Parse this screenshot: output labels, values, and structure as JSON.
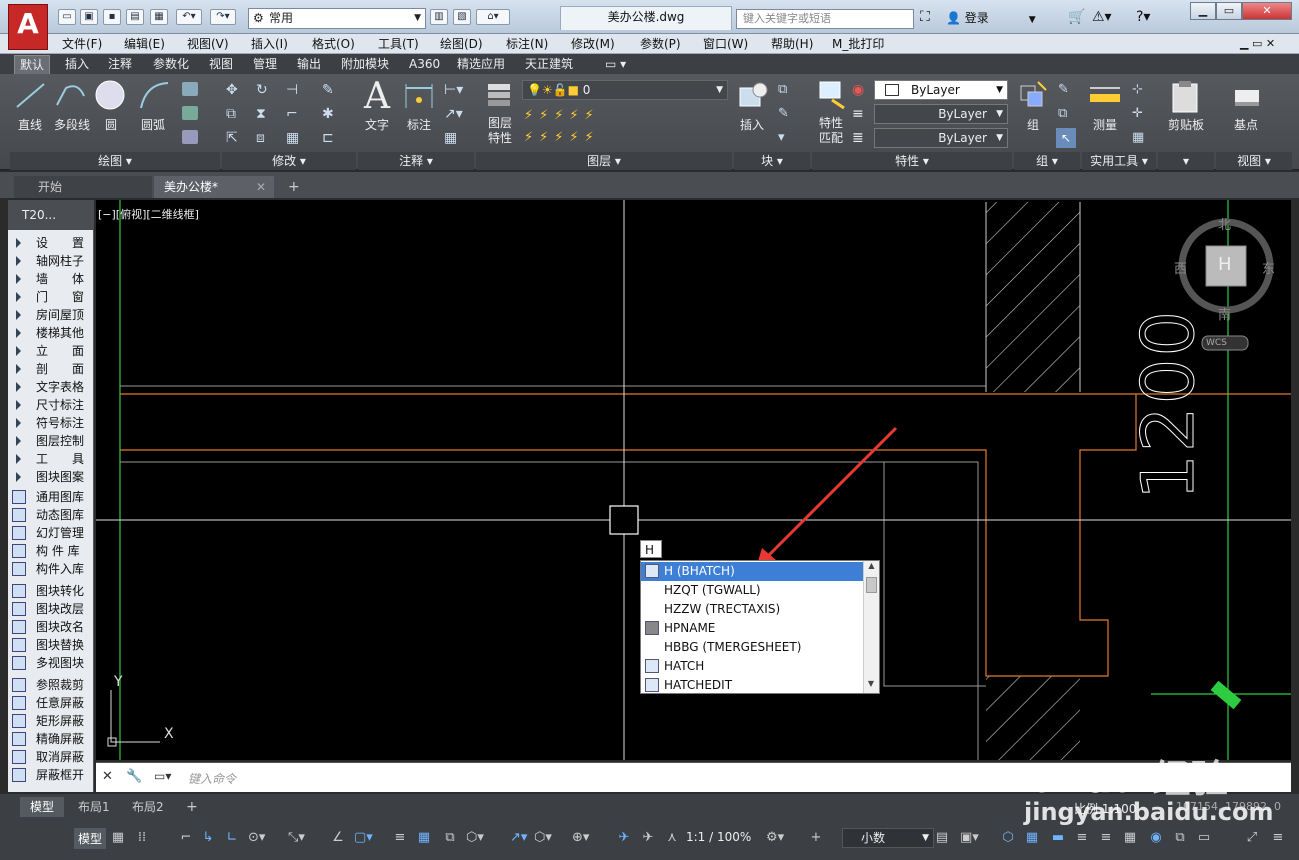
{
  "app": {
    "logo": "A",
    "title": "美办公楼.dwg",
    "workspace": "常用",
    "search_placeholder": "键入关键字或短语",
    "login": "登录"
  },
  "menu": [
    "文件(F)",
    "编辑(E)",
    "视图(V)",
    "插入(I)",
    "格式(O)",
    "工具(T)",
    "绘图(D)",
    "标注(N)",
    "修改(M)",
    "参数(P)",
    "窗口(W)",
    "帮助(H)",
    "M_批打印"
  ],
  "ribbon_tabs": [
    "默认",
    "插入",
    "注释",
    "参数化",
    "视图",
    "管理",
    "输出",
    "附加模块",
    "A360",
    "精选应用",
    "天正建筑"
  ],
  "ribbon": {
    "draw": {
      "items": [
        "直线",
        "多段线",
        "圆",
        "圆弧"
      ],
      "footer": "绘图 ▾"
    },
    "modify": {
      "footer": "修改 ▾"
    },
    "annot": {
      "items": [
        "文字",
        "标注"
      ],
      "footer": "注释 ▾"
    },
    "layer": {
      "label_line1": "图层",
      "label_line2": "特性",
      "current": "0",
      "footer": "图层 ▾"
    },
    "block": {
      "label": "插入",
      "footer": "块 ▾"
    },
    "props": {
      "match_line1": "特性",
      "match_line2": "匹配",
      "bylayer1": "ByLayer",
      "bylayer2": "ByLayer",
      "bylayer3": "ByLayer",
      "footer": "特性 ▾"
    },
    "group": {
      "label": "组",
      "footer": "组 ▾"
    },
    "utils": {
      "label": "测量",
      "footer": "实用工具 ▾"
    },
    "clip": {
      "label": "剪贴板"
    },
    "view": {
      "label": "基点",
      "footer": "视图 ▾"
    }
  },
  "doc_tabs": [
    "开始",
    "美办公楼*"
  ],
  "palette": {
    "header": "T20...",
    "arrow_items": [
      "设　　置",
      "轴网柱子",
      "墙　　体",
      "门　　窗",
      "房间屋顶",
      "楼梯其他",
      "立　　面",
      "剖　　面",
      "文字表格",
      "尺寸标注",
      "符号标注",
      "图层控制",
      "工　　具",
      "图块图案"
    ],
    "icon_items": [
      "通用图库",
      "动态图库",
      "幻灯管理",
      "构 件 库",
      "构件入库",
      "图块转化",
      "图块改层",
      "图块改名",
      "图块替换",
      "多视图块",
      "参照裁剪",
      "任意屏蔽",
      "矩形屏蔽",
      "精确屏蔽",
      "取消屏蔽",
      "屏蔽框开"
    ]
  },
  "viewport": {
    "label": "[−][俯视][二维线框]",
    "compass": {
      "north": "北",
      "south": "南",
      "east": "东",
      "west": "西",
      "center": "H",
      "wcs": "WCS"
    },
    "dimension": "1200",
    "ucs_x": "X",
    "ucs_y": "Y"
  },
  "autocomplete": {
    "typed": "H",
    "items": [
      "H (BHATCH)",
      "HZQT (TGWALL)",
      "HZZW (TRECTAXIS)",
      "HPNAME",
      "HBBG (TMERGESHEET)",
      "HATCH",
      "HATCHEDIT"
    ],
    "selected_index": 0
  },
  "command_line": {
    "placeholder": "键入命令"
  },
  "layout_tabs": [
    "模型",
    "布局1",
    "布局2"
  ],
  "status": {
    "model": "模型",
    "scale_label": "比例 1:100",
    "coords": "107154, 179892, 0",
    "annot_scale": "1:1 / 100%",
    "units": "小数"
  },
  "watermark": {
    "brand": "Bai du 经验",
    "url": "jingyan.baidu.com"
  },
  "colors": {
    "accent": "#3d7fd6",
    "drawing_bg": "#000000",
    "wall_orange": "#e07a2e",
    "axis_green": "#2ecc40",
    "arrow_red": "#e53935"
  }
}
